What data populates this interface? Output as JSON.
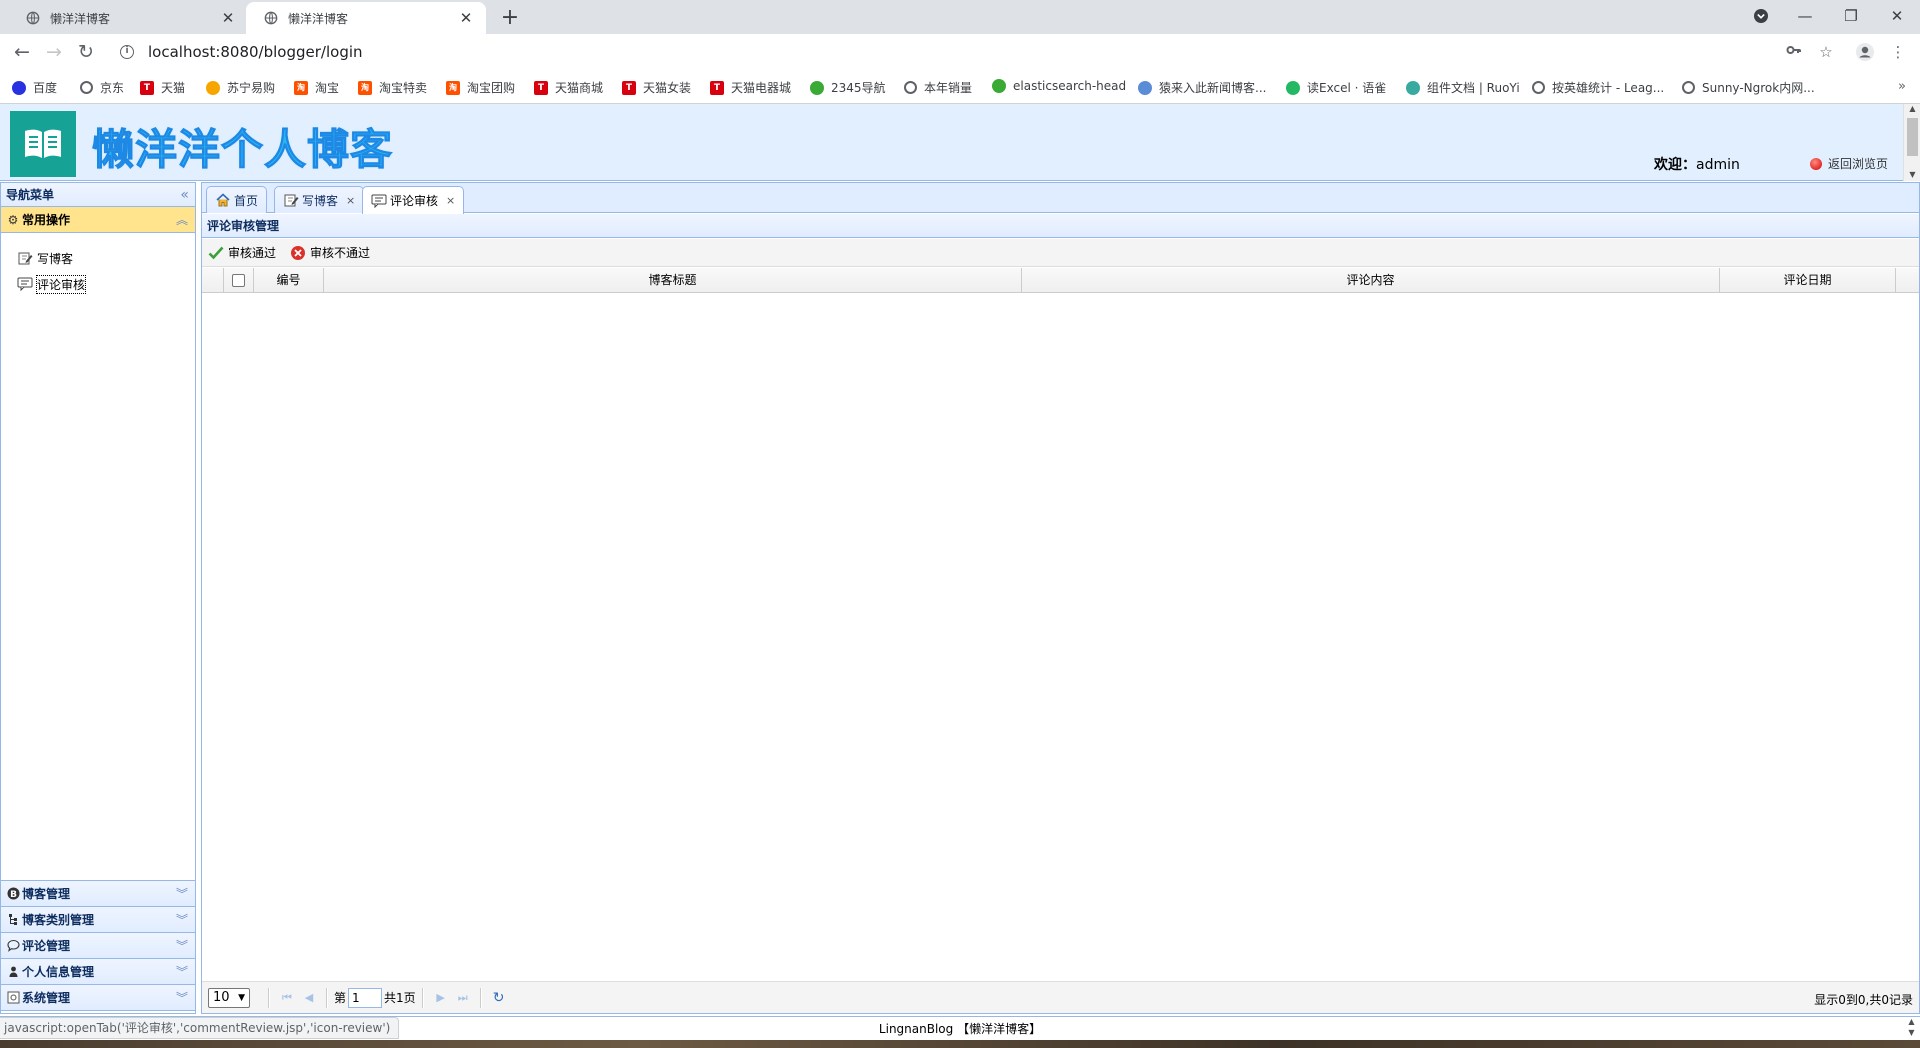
{
  "browser": {
    "tabs": [
      {
        "title": "懒洋洋博客",
        "active": false
      },
      {
        "title": "懒洋洋博客",
        "active": true
      }
    ],
    "url": "localhost:8080/blogger/login",
    "bookmarks": [
      {
        "label": "百度",
        "icon": "baidu-paw-icon",
        "color": "#2932e1"
      },
      {
        "label": "京东",
        "icon": "globe-icon",
        "color": "#5f6368"
      },
      {
        "label": "天猫",
        "icon": "tmall-icon",
        "color": "#d7000f"
      },
      {
        "label": "苏宁易购",
        "icon": "suning-icon",
        "color": "#f7a600"
      },
      {
        "label": "淘宝",
        "icon": "taobao-icon",
        "color": "#ff5000"
      },
      {
        "label": "淘宝特卖",
        "icon": "taobao-icon",
        "color": "#ff5000"
      },
      {
        "label": "淘宝团购",
        "icon": "taobao-icon",
        "color": "#ff5000"
      },
      {
        "label": "天猫商城",
        "icon": "tmall-icon",
        "color": "#d7000f"
      },
      {
        "label": "天猫女装",
        "icon": "tmall-icon",
        "color": "#d7000f"
      },
      {
        "label": "天猫电器城",
        "icon": "tmall-icon",
        "color": "#d7000f"
      },
      {
        "label": "2345导航",
        "icon": "house-icon",
        "color": "#3aa935"
      },
      {
        "label": "本年销量",
        "icon": "globe-icon",
        "color": "#5f6368"
      },
      {
        "label": "elasticsearch-head",
        "icon": "elastic-icon",
        "color": "#3aa935"
      },
      {
        "label": "猿来入此新闻博客...",
        "icon": "yuan-icon",
        "color": "#5a8dd6"
      },
      {
        "label": "读Excel · 语雀",
        "icon": "yuque-icon",
        "color": "#25b864"
      },
      {
        "label": "组件文档 | RuoYi",
        "icon": "ruoyi-icon",
        "color": "#3aa9a0"
      },
      {
        "label": "按英雄统计 - Leag...",
        "icon": "globe-icon",
        "color": "#5f6368"
      },
      {
        "label": "Sunny-Ngrok内网...",
        "icon": "globe-icon",
        "color": "#5f6368"
      }
    ]
  },
  "app": {
    "brand_title": "懒洋洋个人博客",
    "welcome_label": "欢迎：",
    "welcome_user": "admin",
    "back_link": "返回浏览页",
    "west": {
      "title": "导航菜单",
      "groups": [
        {
          "label": "常用操作",
          "icon": "gear-icon"
        },
        {
          "label": "博客管理",
          "icon": "blog-b-icon"
        },
        {
          "label": "博客类别管理",
          "icon": "tree-icon"
        },
        {
          "label": "评论管理",
          "icon": "comment-icon"
        },
        {
          "label": "个人信息管理",
          "icon": "user-icon"
        },
        {
          "label": "系统管理",
          "icon": "system-icon"
        }
      ],
      "links": [
        {
          "label": "写博客",
          "icon": "edit-icon"
        },
        {
          "label": "评论审核",
          "icon": "review-icon"
        }
      ]
    },
    "tabs": [
      {
        "label": "首页",
        "icon": "home-icon",
        "closable": false
      },
      {
        "label": "写博客",
        "icon": "edit-icon",
        "closable": true
      },
      {
        "label": "评论审核",
        "icon": "review-icon",
        "closable": true,
        "active": true
      }
    ],
    "panel_title": "评论审核管理",
    "toolbar": {
      "approve": "审核通过",
      "reject": "审核不通过"
    },
    "grid": {
      "columns": [
        "编号",
        "博客标题",
        "评论内容",
        "评论日期"
      ],
      "rows": []
    },
    "pager": {
      "page_size": "10",
      "page_prefix": "第",
      "page_value": "1",
      "page_total": "共1页",
      "info": "显示0到0,共0记录"
    },
    "footer": "LingnanBlog 【懒洋洋博客】",
    "status_url": "javascript:openTab('评论审核','commentReview.jsp','icon-review')"
  }
}
